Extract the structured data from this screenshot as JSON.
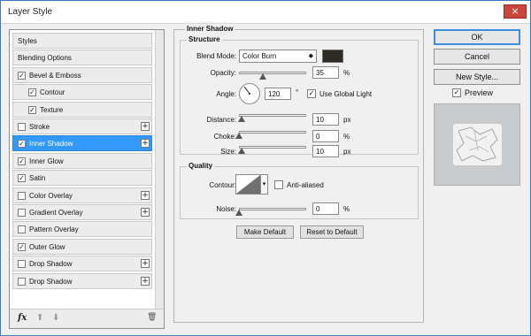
{
  "window": {
    "title": "Layer Style",
    "close": "×"
  },
  "styles": [
    {
      "label": "Styles",
      "checkbox": false,
      "checked": false,
      "plus": false,
      "indent": 0,
      "selected": false
    },
    {
      "label": "Blending Options",
      "checkbox": false,
      "checked": false,
      "plus": false,
      "indent": 0,
      "selected": false
    },
    {
      "label": "Bevel & Emboss",
      "checkbox": true,
      "checked": true,
      "plus": false,
      "indent": 0,
      "selected": false
    },
    {
      "label": "Contour",
      "checkbox": true,
      "checked": true,
      "plus": false,
      "indent": 1,
      "selected": false
    },
    {
      "label": "Texture",
      "checkbox": true,
      "checked": true,
      "plus": false,
      "indent": 1,
      "selected": false
    },
    {
      "label": "Stroke",
      "checkbox": true,
      "checked": false,
      "plus": true,
      "indent": 0,
      "selected": false
    },
    {
      "label": "Inner Shadow",
      "checkbox": true,
      "checked": true,
      "plus": true,
      "indent": 0,
      "selected": true
    },
    {
      "label": "Inner Glow",
      "checkbox": true,
      "checked": true,
      "plus": false,
      "indent": 0,
      "selected": false
    },
    {
      "label": "Satin",
      "checkbox": true,
      "checked": true,
      "plus": false,
      "indent": 0,
      "selected": false
    },
    {
      "label": "Color Overlay",
      "checkbox": true,
      "checked": false,
      "plus": true,
      "indent": 0,
      "selected": false
    },
    {
      "label": "Gradient Overlay",
      "checkbox": true,
      "checked": false,
      "plus": true,
      "indent": 0,
      "selected": false
    },
    {
      "label": "Pattern Overlay",
      "checkbox": true,
      "checked": false,
      "plus": false,
      "indent": 0,
      "selected": false
    },
    {
      "label": "Outer Glow",
      "checkbox": true,
      "checked": true,
      "plus": false,
      "indent": 0,
      "selected": false
    },
    {
      "label": "Drop Shadow",
      "checkbox": true,
      "checked": false,
      "plus": true,
      "indent": 0,
      "selected": false
    },
    {
      "label": "Drop Shadow",
      "checkbox": true,
      "checked": false,
      "plus": true,
      "indent": 0,
      "selected": false
    }
  ],
  "toolbar": {
    "fx": "fx",
    "up": "⬆",
    "down": "⬇",
    "trash": "🗑"
  },
  "inner_shadow": {
    "title": "Inner Shadow",
    "structure": {
      "title": "Structure",
      "blend_mode_label": "Blend Mode:",
      "blend_mode_value": "Color Burn",
      "swatch_color": "#2e2a25",
      "opacity_label": "Opacity:",
      "opacity_value": "35",
      "opacity_unit": "%",
      "opacity_level": 0.35,
      "angle_label": "Angle:",
      "angle_value": "120",
      "angle_unit": "°",
      "use_global_light_label": "Use Global Light",
      "use_global_light_checked": true,
      "distance_label": "Distance:",
      "distance_value": "10",
      "distance_unit": "px",
      "distance_level": 0.04,
      "choke_label": "Choke:",
      "choke_value": "0",
      "choke_unit": "%",
      "choke_level": 0.0,
      "size_label": "Size:",
      "size_value": "10",
      "size_unit": "px",
      "size_level": 0.04
    },
    "quality": {
      "title": "Quality",
      "contour_label": "Contour:",
      "anti_aliased_label": "Anti-aliased",
      "anti_aliased_checked": false,
      "noise_label": "Noise:",
      "noise_value": "0",
      "noise_unit": "%",
      "noise_level": 0.0
    },
    "make_default": "Make Default",
    "reset_default": "Reset to Default"
  },
  "buttons": {
    "ok": "OK",
    "cancel": "Cancel",
    "new_style": "New Style..."
  },
  "preview": {
    "label": "Preview",
    "checked": true
  },
  "colors": {
    "accent": "#3399ff"
  }
}
